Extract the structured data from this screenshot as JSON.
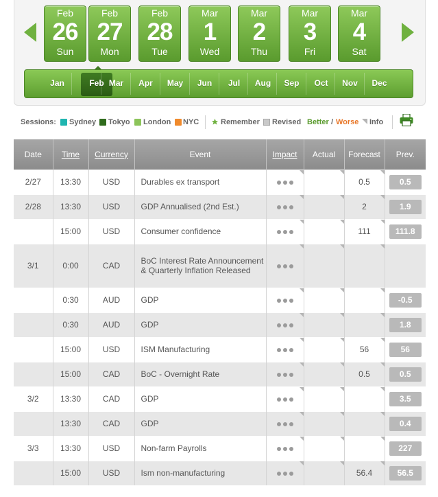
{
  "calendar": {
    "days": [
      {
        "month": "Feb",
        "day": "26",
        "weekday": "Sun"
      },
      {
        "month": "Feb",
        "day": "27",
        "weekday": "Mon"
      },
      {
        "month": "Feb",
        "day": "28",
        "weekday": "Tue"
      },
      {
        "month": "Mar",
        "day": "1",
        "weekday": "Wed"
      },
      {
        "month": "Mar",
        "day": "2",
        "weekday": "Thu"
      },
      {
        "month": "Mar",
        "day": "3",
        "weekday": "Fri"
      },
      {
        "month": "Mar",
        "day": "4",
        "weekday": "Sat"
      }
    ],
    "months": [
      "Jan",
      "Feb",
      "Mar",
      "Apr",
      "May",
      "Jun",
      "Jul",
      "Aug",
      "Sep",
      "Oct",
      "Nov",
      "Dec"
    ],
    "active_month": "Feb"
  },
  "legend": {
    "sessions_label": "Sessions:",
    "sessions": [
      {
        "name": "Sydney",
        "color": "#1fb5b0"
      },
      {
        "name": "Tokyo",
        "color": "#2f6b1c"
      },
      {
        "name": "London",
        "color": "#8cc45a"
      },
      {
        "name": "NYC",
        "color": "#f08a2c"
      }
    ],
    "remember": "Remember",
    "revised": "Revised",
    "better": "Better",
    "slash": "/",
    "worse": "Worse",
    "info": "Info",
    "better_color": "#5a9b2e",
    "worse_color": "#e8782a"
  },
  "table": {
    "headers": {
      "date": "Date",
      "time": "Time",
      "currency": "Currency",
      "event": "Event",
      "impact": "Impact",
      "actual": "Actual",
      "forecast": "Forecast",
      "prev": "Prev."
    },
    "rows": [
      {
        "date": "2/27",
        "time": "13:30",
        "currency": "USD",
        "event": "Durables ex transport",
        "actual": "",
        "forecast": "0.5",
        "prev": "0.5"
      },
      {
        "date": "2/28",
        "time": "13:30",
        "currency": "USD",
        "event": "GDP Annualised (2nd Est.)",
        "actual": "",
        "forecast": "2",
        "prev": "1.9"
      },
      {
        "date": "",
        "time": "15:00",
        "currency": "USD",
        "event": "Consumer confidence",
        "actual": "",
        "forecast": "111",
        "prev": "111.8"
      },
      {
        "date": "3/1",
        "time": "0:00",
        "currency": "CAD",
        "event": "BoC Interest Rate Announcement & Quarterly Inflation Released",
        "actual": "",
        "forecast": "",
        "prev": ""
      },
      {
        "date": "",
        "time": "0:30",
        "currency": "AUD",
        "event": "GDP",
        "actual": "",
        "forecast": "",
        "prev": "-0.5"
      },
      {
        "date": "",
        "time": "0:30",
        "currency": "AUD",
        "event": "GDP",
        "actual": "",
        "forecast": "",
        "prev": "1.8"
      },
      {
        "date": "",
        "time": "15:00",
        "currency": "USD",
        "event": "ISM Manufacturing",
        "actual": "",
        "forecast": "56",
        "prev": "56"
      },
      {
        "date": "",
        "time": "15:00",
        "currency": "CAD",
        "event": "BoC - Overnight Rate",
        "actual": "",
        "forecast": "0.5",
        "prev": "0.5"
      },
      {
        "date": "3/2",
        "time": "13:30",
        "currency": "CAD",
        "event": "GDP",
        "actual": "",
        "forecast": "",
        "prev": "3.5"
      },
      {
        "date": "",
        "time": "13:30",
        "currency": "CAD",
        "event": "GDP",
        "actual": "",
        "forecast": "",
        "prev": "0.4"
      },
      {
        "date": "3/3",
        "time": "13:30",
        "currency": "USD",
        "event": "Non-farm Payrolls",
        "actual": "",
        "forecast": "",
        "prev": "227"
      },
      {
        "date": "",
        "time": "15:00",
        "currency": "USD",
        "event": "Ism non-manufacturing",
        "actual": "",
        "forecast": "56.4",
        "prev": "56.5"
      }
    ]
  }
}
